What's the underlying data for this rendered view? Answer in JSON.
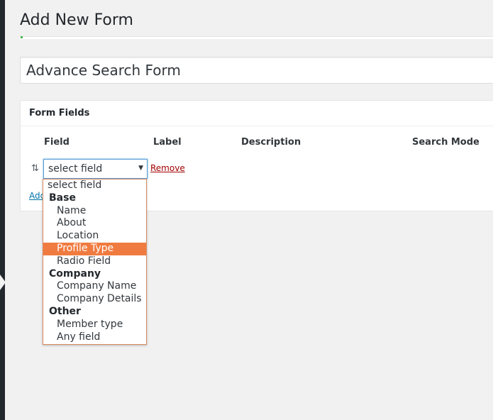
{
  "page": {
    "title": "Add New Form"
  },
  "form": {
    "name_value": "Advance Search Form"
  },
  "panel": {
    "title": "Form Fields",
    "columns": [
      "Field",
      "Label",
      "Description",
      "Search Mode"
    ]
  },
  "field_row": {
    "select_value": "select field",
    "remove_label": "Remove",
    "add_label": "Add"
  },
  "dropdown": {
    "top_option": "select field",
    "groups": [
      {
        "label": "Base",
        "options": [
          "Name",
          "About",
          "Location",
          "Profile Type",
          "Radio Field"
        ]
      },
      {
        "label": "Company",
        "options": [
          "Company Name",
          "Company Details"
        ]
      },
      {
        "label": "Other",
        "options": [
          "Member type",
          "Any field"
        ]
      }
    ],
    "highlighted": "Profile Type"
  },
  "colors": {
    "highlight": "#f07b40",
    "remove_link": "#a00000",
    "link": "#0073aa",
    "sidebar": "#23282d"
  },
  "icons": {
    "sort_handle": "up-down-arrows-icon",
    "select_arrow": "caret-down-icon"
  }
}
